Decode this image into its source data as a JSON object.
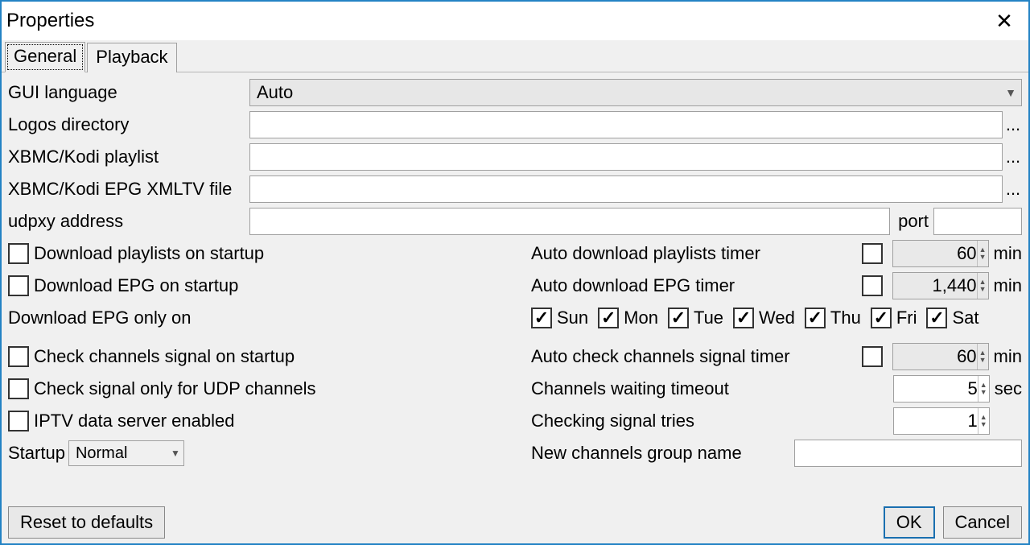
{
  "window": {
    "title": "Properties"
  },
  "tabs": {
    "general": "General",
    "playback": "Playback"
  },
  "labels": {
    "gui_language": "GUI language",
    "logos_directory": "Logos directory",
    "kodi_playlist": "XBMC/Kodi playlist",
    "kodi_epg": "XBMC/Kodi EPG XMLTV file",
    "udpxy_address": "udpxy address",
    "port": "port",
    "dl_playlists_startup": "Download playlists on startup",
    "dl_epg_startup": "Download EPG on startup",
    "auto_dl_playlists_timer": "Auto download playlists timer",
    "auto_dl_epg_timer": "Auto download EPG timer",
    "min": "min",
    "sec": "sec",
    "dl_epg_only_on": "Download EPG only on",
    "check_channels_startup": "Check channels signal on startup",
    "check_udp_only": "Check signal only for UDP channels",
    "iptv_server_enabled": "IPTV data server enabled",
    "auto_check_signal_timer": "Auto check channels signal timer",
    "channels_waiting_timeout": "Channels waiting timeout",
    "checking_signal_tries": "Checking signal tries",
    "new_channels_group": "New channels group name",
    "startup": "Startup"
  },
  "values": {
    "gui_language": "Auto",
    "logos_directory": "",
    "kodi_playlist": "",
    "kodi_epg": "",
    "udpxy_address": "",
    "port": "",
    "playlists_timer": "60",
    "epg_timer": "1,440",
    "signal_timer": "60",
    "waiting_timeout": "5",
    "signal_tries": "1",
    "new_group": "",
    "startup_mode": "Normal"
  },
  "checks": {
    "dl_playlists_startup": false,
    "dl_epg_startup": false,
    "auto_dl_playlists_timer": false,
    "auto_dl_epg_timer": false,
    "check_channels_startup": false,
    "check_udp_only": false,
    "iptv_server_enabled": false,
    "auto_check_signal_timer": false
  },
  "days": {
    "sun": {
      "label": "Sun",
      "checked": true
    },
    "mon": {
      "label": "Mon",
      "checked": true
    },
    "tue": {
      "label": "Tue",
      "checked": true
    },
    "wed": {
      "label": "Wed",
      "checked": true
    },
    "thu": {
      "label": "Thu",
      "checked": true
    },
    "fri": {
      "label": "Fri",
      "checked": true
    },
    "sat": {
      "label": "Sat",
      "checked": true
    }
  },
  "buttons": {
    "reset": "Reset to defaults",
    "ok": "OK",
    "cancel": "Cancel",
    "browse": "..."
  }
}
